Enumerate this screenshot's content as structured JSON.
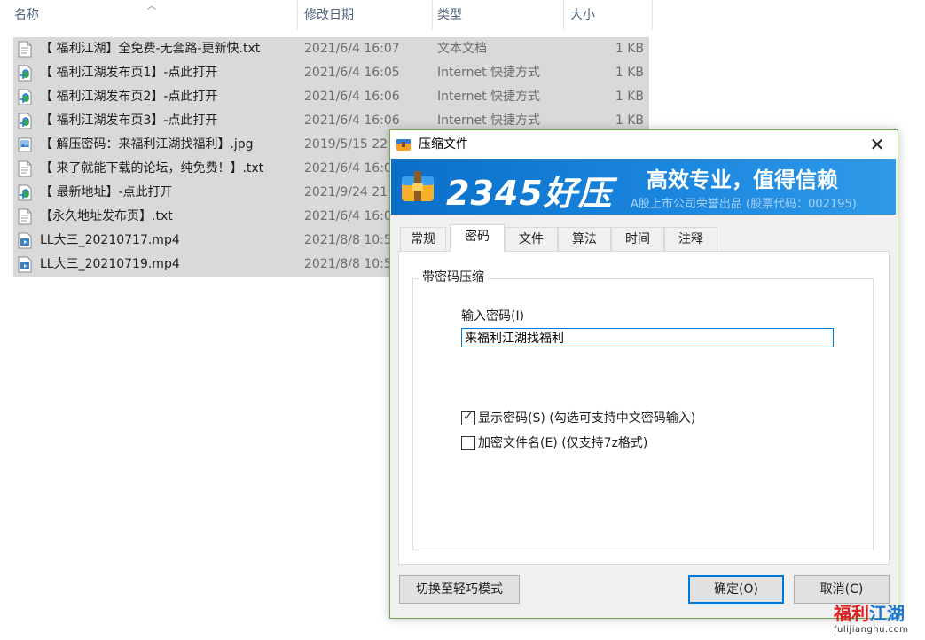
{
  "explorer": {
    "columns": {
      "name": "名称",
      "date": "修改日期",
      "type": "类型",
      "size": "大小"
    },
    "files": [
      {
        "icon": "text-file-icon",
        "name": "【 福利江湖】全免费-无套路-更新快.txt",
        "date": "2021/6/4 16:07",
        "type": "文本文档",
        "size": "1 KB"
      },
      {
        "icon": "internet-shortcut-icon",
        "name": "【 福利江湖发布页1】-点此打开",
        "date": "2021/6/4 16:05",
        "type": "Internet 快捷方式",
        "size": "1 KB"
      },
      {
        "icon": "internet-shortcut-icon",
        "name": "【 福利江湖发布页2】-点此打开",
        "date": "2021/6/4 16:06",
        "type": "Internet 快捷方式",
        "size": "1 KB"
      },
      {
        "icon": "internet-shortcut-icon",
        "name": "【 福利江湖发布页3】-点此打开",
        "date": "2021/6/4 16:06",
        "type": "Internet 快捷方式",
        "size": "1 KB"
      },
      {
        "icon": "image-file-icon",
        "name": "【 解压密码：来福利江湖找福利】.jpg",
        "date": "2019/5/15 22",
        "type": "",
        "size": ""
      },
      {
        "icon": "text-file-icon",
        "name": "【 来了就能下载的论坛，纯免费！】.txt",
        "date": "2021/6/4 16:0",
        "type": "",
        "size": ""
      },
      {
        "icon": "internet-shortcut-icon",
        "name": "【 最新地址】-点此打开",
        "date": "2021/9/24 21",
        "type": "",
        "size": ""
      },
      {
        "icon": "text-file-icon",
        "name": "【永久地址发布页】.txt",
        "date": "2021/6/4 16:0",
        "type": "",
        "size": ""
      },
      {
        "icon": "video-file-icon",
        "name": "LL大三_20210717.mp4",
        "date": "2021/8/8 10:5",
        "type": "",
        "size": ""
      },
      {
        "icon": "video-file-icon",
        "name": "LL大三_20210719.mp4",
        "date": "2021/8/8 10:5",
        "type": "",
        "size": ""
      }
    ]
  },
  "dialog": {
    "title": "压缩文件",
    "close_glyph": "✕",
    "banner": {
      "brand": "2345好压",
      "slogan": "高效专业，值得信赖",
      "subtitle": "A股上市公司荣誉出品 (股票代码：002195)"
    },
    "tabs": [
      "常规",
      "密码",
      "文件",
      "算法",
      "时间",
      "注释"
    ],
    "active_tab": "密码",
    "group_title": "带密码压缩",
    "password_label": "输入密码(I)",
    "password_value": "来福利江湖找福利",
    "show_password": {
      "label": "显示密码(S) (勾选可支持中文密码输入)",
      "checked": true
    },
    "encrypt_names": {
      "label": "加密文件名(E) (仅支持7z格式)",
      "checked": false
    },
    "buttons": {
      "switch": "切换至轻巧模式",
      "ok": "确定(O)",
      "cancel": "取消(C)"
    }
  },
  "watermark": {
    "part1": "福利",
    "part2": "江湖",
    "url": "fulijianghu.com"
  },
  "colors": {
    "selection": "#d9d9d9",
    "banner": "#1b86de",
    "accent": "#0078d7",
    "dialog_border": "#6fa845"
  }
}
